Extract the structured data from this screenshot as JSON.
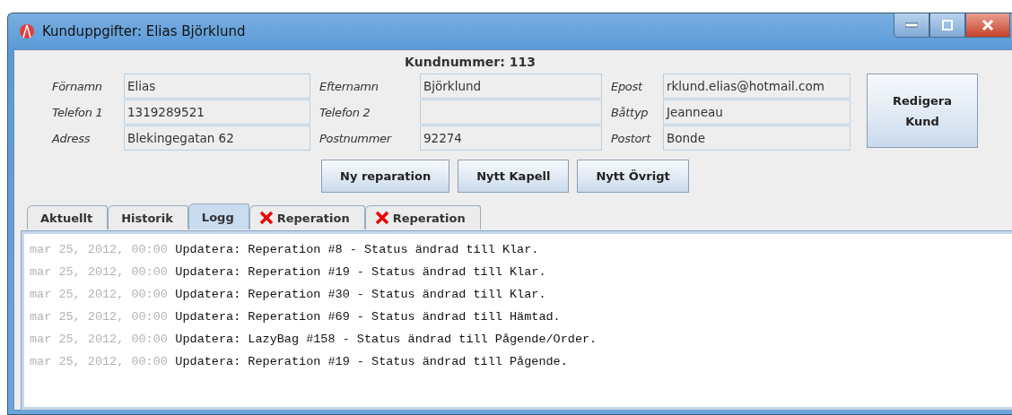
{
  "window": {
    "title": "Kunduppgifter: Elias Björklund"
  },
  "customer_number": "Kundnummer: 113",
  "fields": [
    {
      "label": "Förnamn",
      "value": "Elias"
    },
    {
      "label": "Efternamn",
      "value": "Björklund"
    },
    {
      "label": "Epost",
      "value": "rklund.elias@hotmail.com"
    },
    {
      "label": "Telefon 1",
      "value": "1319289521"
    },
    {
      "label": "Telefon 2"
    },
    {
      "label": "Båttyp",
      "value": "Jeanneau"
    },
    {
      "label": "Adress",
      "value": "Blekingegatan 62"
    },
    {
      "label": "Postnummer",
      "value": "92274"
    },
    {
      "label": "Postort",
      "value": "Bonde"
    }
  ],
  "edit_button": "Redigera Kund",
  "actions": [
    "Ny reparation",
    "Nytt Kapell",
    "Nytt Övrigt"
  ],
  "tabs": [
    {
      "label": "Aktuellt",
      "selected": false,
      "closable": false
    },
    {
      "label": "Historik",
      "selected": false,
      "closable": false
    },
    {
      "label": "Logg",
      "selected": true,
      "closable": false
    },
    {
      "label": "Reperation",
      "selected": false,
      "closable": true
    },
    {
      "label": "Reperation",
      "selected": false,
      "closable": true
    }
  ],
  "log": [
    {
      "time": "mar 25, 2012, 00:00",
      "message": "Updatera: Reperation #8 - Status ändrad till Klar."
    },
    {
      "time": "mar 25, 2012, 00:00",
      "message": "Updatera: Reperation #19 - Status ändrad till Klar."
    },
    {
      "time": "mar 25, 2012, 00:00",
      "message": "Updatera: Reperation #30 - Status ändrad till Klar."
    },
    {
      "time": "mar 25, 2012, 00:00",
      "message": "Updatera: Reperation #69 - Status ändrad till Hämtad."
    },
    {
      "time": "mar 25, 2012, 00:00",
      "message": "Updatera: LazyBag #158 - Status ändrad till Pågende/Order."
    },
    {
      "time": "mar 25, 2012, 00:00",
      "message": "Updatera: Reperation #19 - Status ändrad till Pågende."
    }
  ]
}
